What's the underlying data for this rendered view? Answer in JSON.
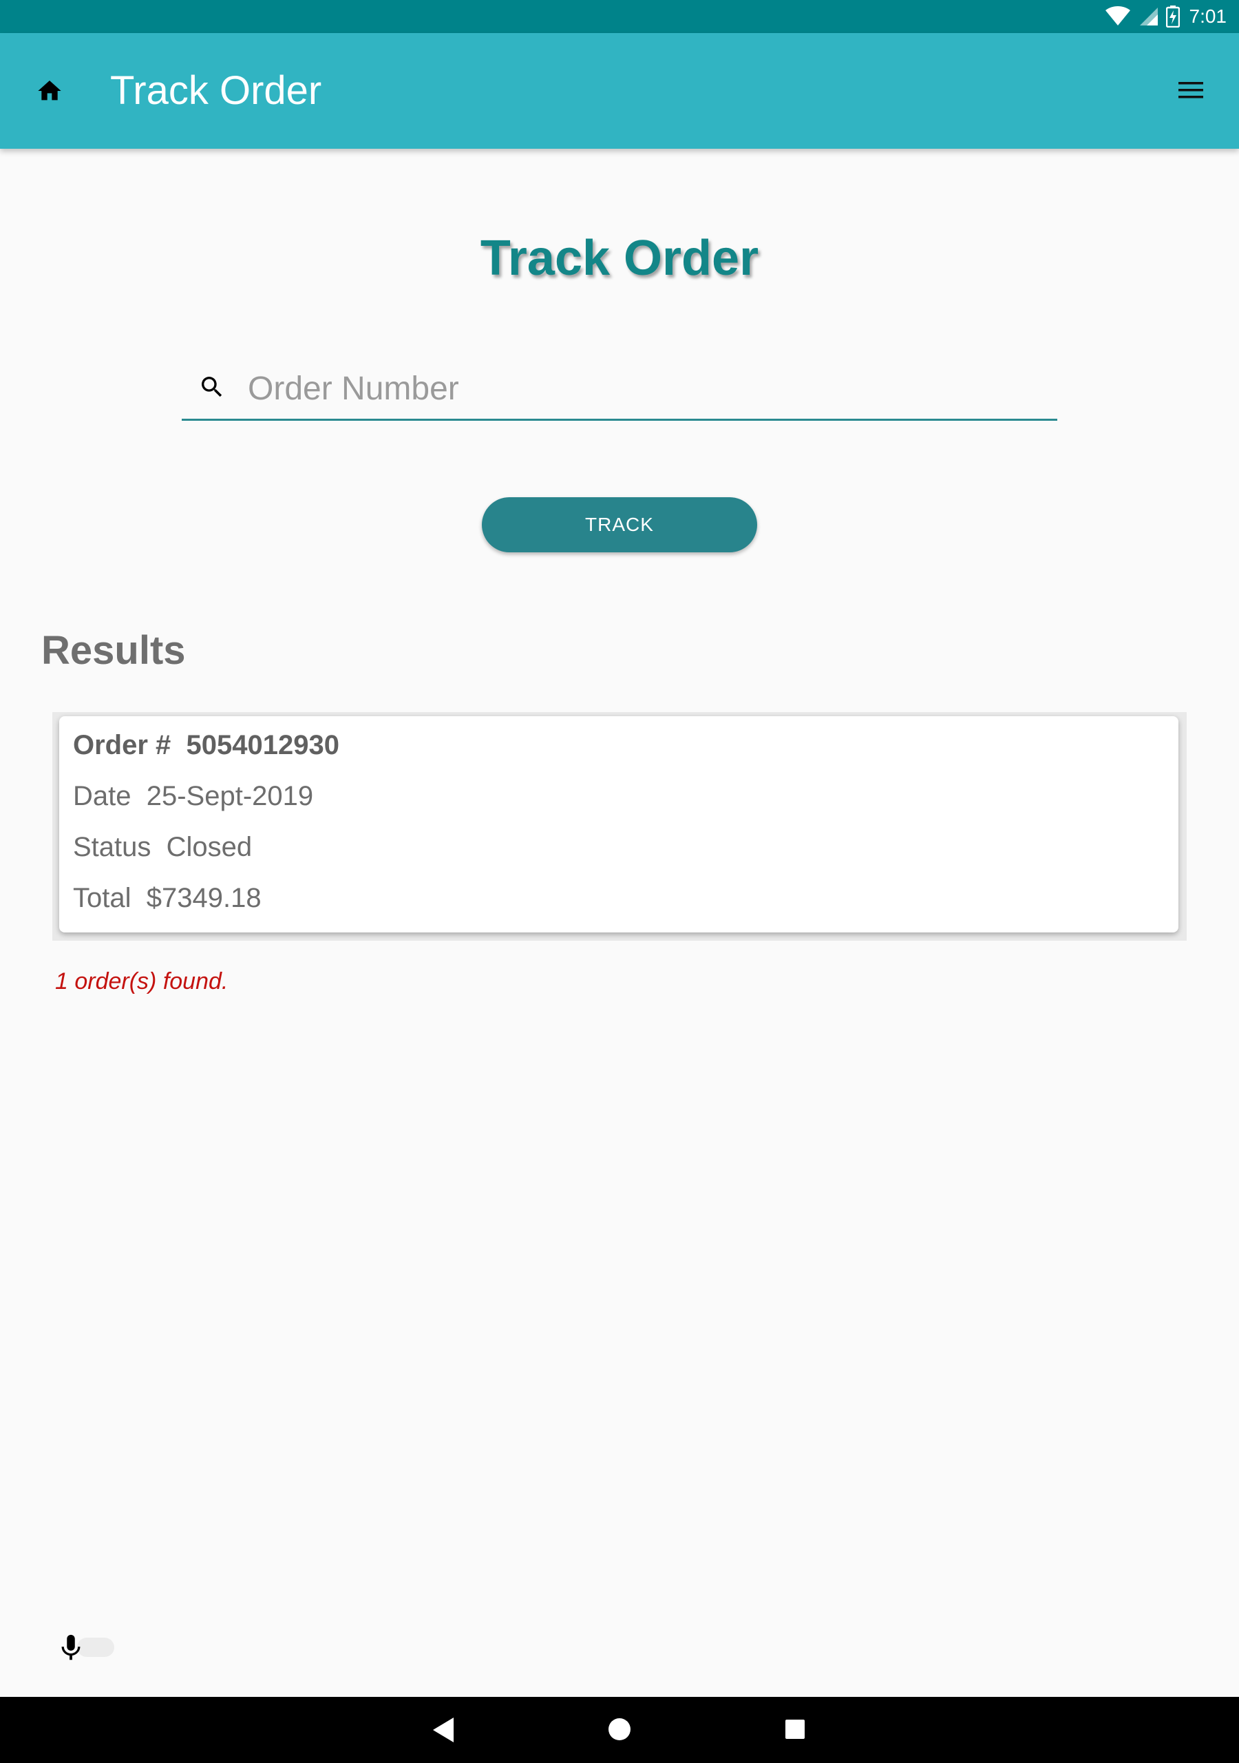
{
  "status_bar": {
    "time": "7:01",
    "icons": [
      "wifi-icon",
      "cell-signal-icon",
      "battery-charging-icon"
    ]
  },
  "app_bar": {
    "title": "Track Order",
    "left_icon": "home-icon",
    "right_icon": "menu-icon"
  },
  "page": {
    "heading": "Track Order"
  },
  "search": {
    "placeholder": "Order Number",
    "value": "",
    "icon": "search-icon"
  },
  "track_button": {
    "label": "TRACK"
  },
  "results": {
    "heading": "Results",
    "orders": [
      {
        "order_label": "Order #",
        "order_number": "5054012930",
        "date_label": "Date",
        "date": "25-Sept-2019",
        "status_label": "Status",
        "status": "Closed",
        "total_label": "Total",
        "total": "$7349.18"
      }
    ],
    "found_text": "1 order(s) found."
  },
  "voice": {
    "icon": "microphone-icon"
  },
  "nav_bar": {
    "icons": [
      "back-icon",
      "home-circle-icon",
      "recent-apps-icon"
    ]
  },
  "colors": {
    "status_bar": "#00838a",
    "app_bar": "#31b4c2",
    "heading_teal": "#138688",
    "button": "#28848c",
    "found_text": "#c4120f"
  }
}
